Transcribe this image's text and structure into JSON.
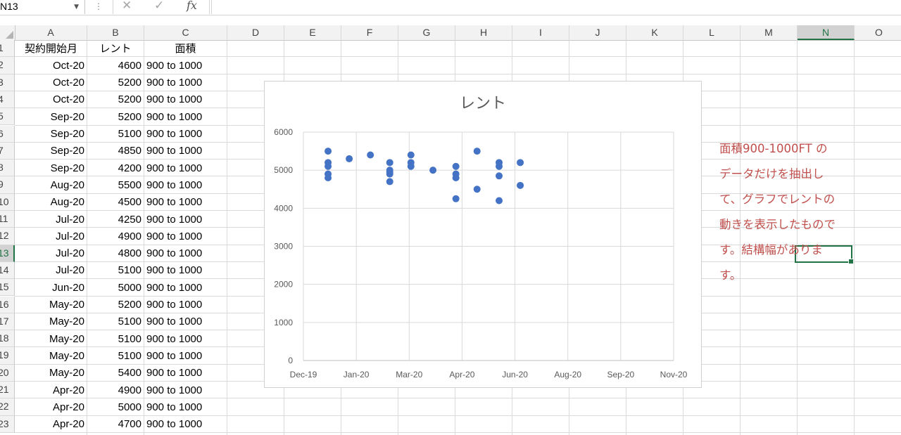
{
  "formula_bar": {
    "name_box": "N13",
    "cancel_icon": "✕",
    "enter_icon": "✓",
    "fx_label": "fx",
    "formula": ""
  },
  "columns": [
    "A",
    "B",
    "C",
    "D",
    "E",
    "F",
    "G",
    "H",
    "I",
    "J",
    "K",
    "L",
    "M",
    "N",
    "O"
  ],
  "active_column": "N",
  "row_numbers": [
    "1",
    "2",
    "3",
    "4",
    "5",
    "6",
    "7",
    "8",
    "9",
    "10",
    "11",
    "12",
    "13",
    "14",
    "15",
    "16",
    "17",
    "18",
    "19",
    "20",
    "21",
    "22",
    "23"
  ],
  "active_row": "13",
  "headers": {
    "a": "契約開始月",
    "b": "レント",
    "c": "面積"
  },
  "rows": [
    {
      "month": "Oct-20",
      "rent": "4600",
      "area": "900 to 1000"
    },
    {
      "month": "Oct-20",
      "rent": "5200",
      "area": "900 to 1000"
    },
    {
      "month": "Oct-20",
      "rent": "5200",
      "area": "900 to 1000"
    },
    {
      "month": "Sep-20",
      "rent": "5200",
      "area": "900 to 1000"
    },
    {
      "month": "Sep-20",
      "rent": "5100",
      "area": "900 to 1000"
    },
    {
      "month": "Sep-20",
      "rent": "4850",
      "area": "900 to 1000"
    },
    {
      "month": "Sep-20",
      "rent": "4200",
      "area": "900 to 1000"
    },
    {
      "month": "Aug-20",
      "rent": "5500",
      "area": "900 to 1000"
    },
    {
      "month": "Aug-20",
      "rent": "4500",
      "area": "900 to 1000"
    },
    {
      "month": "Jul-20",
      "rent": "4250",
      "area": "900 to 1000"
    },
    {
      "month": "Jul-20",
      "rent": "4900",
      "area": "900 to 1000"
    },
    {
      "month": "Jul-20",
      "rent": "4800",
      "area": "900 to 1000"
    },
    {
      "month": "Jul-20",
      "rent": "5100",
      "area": "900 to 1000"
    },
    {
      "month": "Jun-20",
      "rent": "5000",
      "area": "900 to 1000"
    },
    {
      "month": "May-20",
      "rent": "5200",
      "area": "900 to 1000"
    },
    {
      "month": "May-20",
      "rent": "5100",
      "area": "900 to 1000"
    },
    {
      "month": "May-20",
      "rent": "5100",
      "area": "900 to 1000"
    },
    {
      "month": "May-20",
      "rent": "5100",
      "area": "900 to 1000"
    },
    {
      "month": "May-20",
      "rent": "5400",
      "area": "900 to 1000"
    },
    {
      "month": "Apr-20",
      "rent": "4900",
      "area": "900 to 1000"
    },
    {
      "month": "Apr-20",
      "rent": "5000",
      "area": "900 to 1000"
    },
    {
      "month": "Apr-20",
      "rent": "4700",
      "area": "900 to 1000"
    }
  ],
  "note": "面積900-1000FT の\nデータだけを抽出し\nて、グラフでレントの\n動きを表示したもので\nす。結構幅がありま\nす。",
  "colors": {
    "marker": "#4472c4",
    "note": "#c0504d",
    "selection": "#217346"
  },
  "chart_data": {
    "type": "scatter",
    "title": "レント",
    "xlabel": "",
    "ylabel": "",
    "x_tick_labels": [
      "Dec-19",
      "Jan-20",
      "Mar-20",
      "Apr-20",
      "Jun-20",
      "Aug-20",
      "Sep-20",
      "Nov-20"
    ],
    "x_tick_dates": [
      "2019-12-01",
      "2020-01-30",
      "2020-03-30",
      "2020-05-29",
      "2020-07-28",
      "2020-09-26",
      "2020-11-25",
      "2021-01-24"
    ],
    "xlim": [
      "2019-12-01",
      "2021-01-24"
    ],
    "y_ticks": [
      "0",
      "1000",
      "2000",
      "3000",
      "4000",
      "5000",
      "6000"
    ],
    "ylim": [
      0,
      6000
    ],
    "grid": true,
    "legend": "none",
    "points": [
      {
        "x": "2019-12-29",
        "y": 5500
      },
      {
        "x": "2019-12-29",
        "y": 5200
      },
      {
        "x": "2019-12-29",
        "y": 5100
      },
      {
        "x": "2019-12-29",
        "y": 4900
      },
      {
        "x": "2019-12-29",
        "y": 4800
      },
      {
        "x": "2020-01-22",
        "y": 5300
      },
      {
        "x": "2020-02-15",
        "y": 5400
      },
      {
        "x": "2020-03-08",
        "y": 5200
      },
      {
        "x": "2020-03-08",
        "y": 5000
      },
      {
        "x": "2020-03-08",
        "y": 4950
      },
      {
        "x": "2020-03-08",
        "y": 4900
      },
      {
        "x": "2020-03-08",
        "y": 4700
      },
      {
        "x": "2020-04-01",
        "y": 5400
      },
      {
        "x": "2020-04-01",
        "y": 5200
      },
      {
        "x": "2020-04-01",
        "y": 5100
      },
      {
        "x": "2020-04-26",
        "y": 5000
      },
      {
        "x": "2020-05-22",
        "y": 5100
      },
      {
        "x": "2020-05-22",
        "y": 4900
      },
      {
        "x": "2020-05-22",
        "y": 4800
      },
      {
        "x": "2020-05-22",
        "y": 4250
      },
      {
        "x": "2020-06-15",
        "y": 5500
      },
      {
        "x": "2020-06-15",
        "y": 4500
      },
      {
        "x": "2020-07-10",
        "y": 5200
      },
      {
        "x": "2020-07-10",
        "y": 5100
      },
      {
        "x": "2020-07-10",
        "y": 4850
      },
      {
        "x": "2020-07-10",
        "y": 4200
      },
      {
        "x": "2020-08-03",
        "y": 5200
      },
      {
        "x": "2020-08-03",
        "y": 4600
      }
    ]
  }
}
